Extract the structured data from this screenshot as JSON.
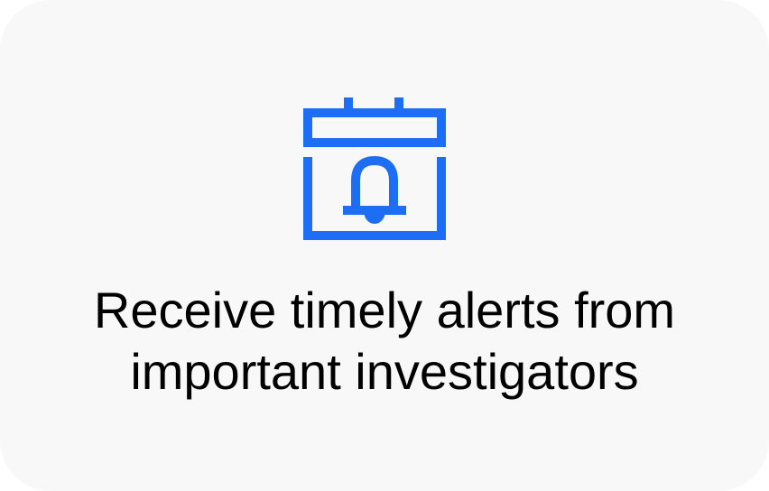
{
  "feature_card": {
    "icon": "calendar-bell-icon",
    "accent_color": "#1d6ef5",
    "background_color": "#f8f8f8",
    "text_color": "#000000",
    "title_lines": [
      "Receive timely alerts from",
      "important investigators"
    ]
  }
}
